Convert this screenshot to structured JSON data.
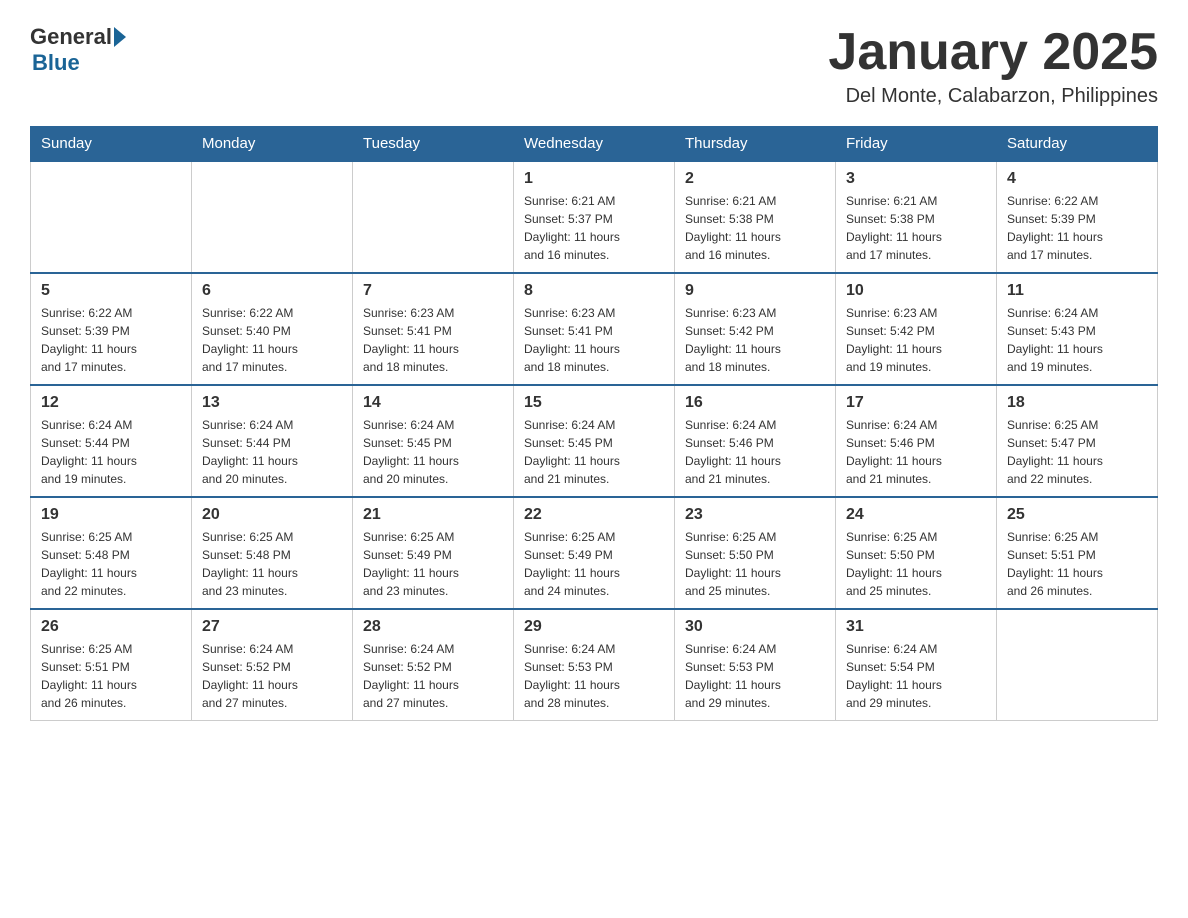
{
  "header": {
    "logo_general": "General",
    "logo_blue": "Blue",
    "month_title": "January 2025",
    "location": "Del Monte, Calabarzon, Philippines"
  },
  "days_of_week": [
    "Sunday",
    "Monday",
    "Tuesday",
    "Wednesday",
    "Thursday",
    "Friday",
    "Saturday"
  ],
  "weeks": [
    {
      "days": [
        {
          "day": "",
          "info": ""
        },
        {
          "day": "",
          "info": ""
        },
        {
          "day": "",
          "info": ""
        },
        {
          "day": "1",
          "info": "Sunrise: 6:21 AM\nSunset: 5:37 PM\nDaylight: 11 hours\nand 16 minutes."
        },
        {
          "day": "2",
          "info": "Sunrise: 6:21 AM\nSunset: 5:38 PM\nDaylight: 11 hours\nand 16 minutes."
        },
        {
          "day": "3",
          "info": "Sunrise: 6:21 AM\nSunset: 5:38 PM\nDaylight: 11 hours\nand 17 minutes."
        },
        {
          "day": "4",
          "info": "Sunrise: 6:22 AM\nSunset: 5:39 PM\nDaylight: 11 hours\nand 17 minutes."
        }
      ]
    },
    {
      "days": [
        {
          "day": "5",
          "info": "Sunrise: 6:22 AM\nSunset: 5:39 PM\nDaylight: 11 hours\nand 17 minutes."
        },
        {
          "day": "6",
          "info": "Sunrise: 6:22 AM\nSunset: 5:40 PM\nDaylight: 11 hours\nand 17 minutes."
        },
        {
          "day": "7",
          "info": "Sunrise: 6:23 AM\nSunset: 5:41 PM\nDaylight: 11 hours\nand 18 minutes."
        },
        {
          "day": "8",
          "info": "Sunrise: 6:23 AM\nSunset: 5:41 PM\nDaylight: 11 hours\nand 18 minutes."
        },
        {
          "day": "9",
          "info": "Sunrise: 6:23 AM\nSunset: 5:42 PM\nDaylight: 11 hours\nand 18 minutes."
        },
        {
          "day": "10",
          "info": "Sunrise: 6:23 AM\nSunset: 5:42 PM\nDaylight: 11 hours\nand 19 minutes."
        },
        {
          "day": "11",
          "info": "Sunrise: 6:24 AM\nSunset: 5:43 PM\nDaylight: 11 hours\nand 19 minutes."
        }
      ]
    },
    {
      "days": [
        {
          "day": "12",
          "info": "Sunrise: 6:24 AM\nSunset: 5:44 PM\nDaylight: 11 hours\nand 19 minutes."
        },
        {
          "day": "13",
          "info": "Sunrise: 6:24 AM\nSunset: 5:44 PM\nDaylight: 11 hours\nand 20 minutes."
        },
        {
          "day": "14",
          "info": "Sunrise: 6:24 AM\nSunset: 5:45 PM\nDaylight: 11 hours\nand 20 minutes."
        },
        {
          "day": "15",
          "info": "Sunrise: 6:24 AM\nSunset: 5:45 PM\nDaylight: 11 hours\nand 21 minutes."
        },
        {
          "day": "16",
          "info": "Sunrise: 6:24 AM\nSunset: 5:46 PM\nDaylight: 11 hours\nand 21 minutes."
        },
        {
          "day": "17",
          "info": "Sunrise: 6:24 AM\nSunset: 5:46 PM\nDaylight: 11 hours\nand 21 minutes."
        },
        {
          "day": "18",
          "info": "Sunrise: 6:25 AM\nSunset: 5:47 PM\nDaylight: 11 hours\nand 22 minutes."
        }
      ]
    },
    {
      "days": [
        {
          "day": "19",
          "info": "Sunrise: 6:25 AM\nSunset: 5:48 PM\nDaylight: 11 hours\nand 22 minutes."
        },
        {
          "day": "20",
          "info": "Sunrise: 6:25 AM\nSunset: 5:48 PM\nDaylight: 11 hours\nand 23 minutes."
        },
        {
          "day": "21",
          "info": "Sunrise: 6:25 AM\nSunset: 5:49 PM\nDaylight: 11 hours\nand 23 minutes."
        },
        {
          "day": "22",
          "info": "Sunrise: 6:25 AM\nSunset: 5:49 PM\nDaylight: 11 hours\nand 24 minutes."
        },
        {
          "day": "23",
          "info": "Sunrise: 6:25 AM\nSunset: 5:50 PM\nDaylight: 11 hours\nand 25 minutes."
        },
        {
          "day": "24",
          "info": "Sunrise: 6:25 AM\nSunset: 5:50 PM\nDaylight: 11 hours\nand 25 minutes."
        },
        {
          "day": "25",
          "info": "Sunrise: 6:25 AM\nSunset: 5:51 PM\nDaylight: 11 hours\nand 26 minutes."
        }
      ]
    },
    {
      "days": [
        {
          "day": "26",
          "info": "Sunrise: 6:25 AM\nSunset: 5:51 PM\nDaylight: 11 hours\nand 26 minutes."
        },
        {
          "day": "27",
          "info": "Sunrise: 6:24 AM\nSunset: 5:52 PM\nDaylight: 11 hours\nand 27 minutes."
        },
        {
          "day": "28",
          "info": "Sunrise: 6:24 AM\nSunset: 5:52 PM\nDaylight: 11 hours\nand 27 minutes."
        },
        {
          "day": "29",
          "info": "Sunrise: 6:24 AM\nSunset: 5:53 PM\nDaylight: 11 hours\nand 28 minutes."
        },
        {
          "day": "30",
          "info": "Sunrise: 6:24 AM\nSunset: 5:53 PM\nDaylight: 11 hours\nand 29 minutes."
        },
        {
          "day": "31",
          "info": "Sunrise: 6:24 AM\nSunset: 5:54 PM\nDaylight: 11 hours\nand 29 minutes."
        },
        {
          "day": "",
          "info": ""
        }
      ]
    }
  ]
}
